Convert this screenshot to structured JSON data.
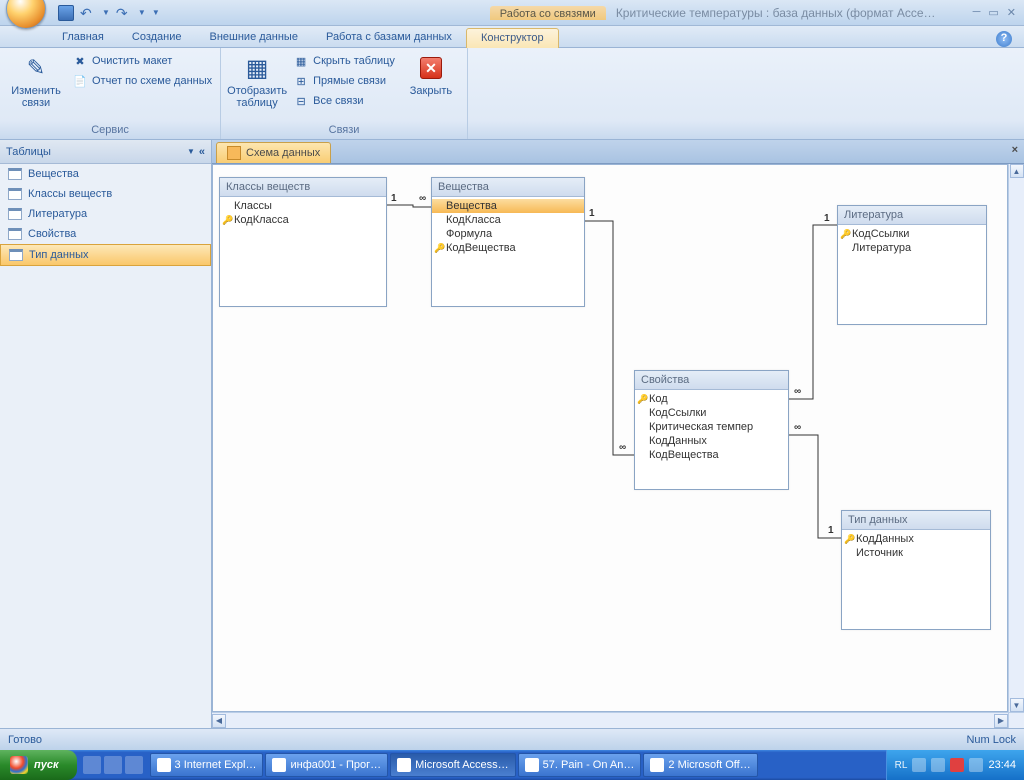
{
  "title": {
    "contextual": "Работа со связями",
    "document": "Критические температуры : база данных (формат Acce…"
  },
  "ribbon_tabs": [
    "Главная",
    "Создание",
    "Внешние данные",
    "Работа с базами данных"
  ],
  "contextual_tab": "Конструктор",
  "ribbon": {
    "group1": {
      "label": "Сервис",
      "big": "Изменить связи",
      "clear": "Очистить макет",
      "report": "Отчет по схеме данных"
    },
    "group2": {
      "label": "Связи",
      "show_table": "Отобразить таблицу",
      "hide": "Скрыть таблицу",
      "direct": "Прямые связи",
      "all": "Все связи",
      "close": "Закрыть"
    }
  },
  "nav": {
    "header": "Таблицы",
    "items": [
      "Вещества",
      "Классы веществ",
      "Литература",
      "Свойства",
      "Тип данных"
    ],
    "selected": 4
  },
  "doc_tab": "Схема данных",
  "tables": {
    "t1": {
      "title": "Классы веществ",
      "fields": [
        {
          "n": "Классы"
        },
        {
          "n": "КодКласса",
          "k": true
        }
      ]
    },
    "t2": {
      "title": "Вещества",
      "fields": [
        {
          "n": "Вещества",
          "sel": true
        },
        {
          "n": "КодКласса"
        },
        {
          "n": "Формула"
        },
        {
          "n": "КодВещества",
          "k": true
        }
      ]
    },
    "t3": {
      "title": "Свойства",
      "fields": [
        {
          "n": "Код",
          "k": true
        },
        {
          "n": "КодСсылки"
        },
        {
          "n": "Критическая темпер"
        },
        {
          "n": "КодДанных"
        },
        {
          "n": "КодВещества"
        }
      ]
    },
    "t4": {
      "title": "Литература",
      "fields": [
        {
          "n": "КодСсылки",
          "k": true
        },
        {
          "n": "Литература"
        }
      ]
    },
    "t5": {
      "title": "Тип данных",
      "fields": [
        {
          "n": "КодДанных",
          "k": true
        },
        {
          "n": "Источник"
        }
      ]
    }
  },
  "rel_labels": {
    "one": "1",
    "many": "∞"
  },
  "status": {
    "left": "Готово",
    "right": "Num Lock"
  },
  "taskbar": {
    "start": "пуск",
    "tasks": [
      "3 Internet Expl…",
      "инфа001 - Прог…",
      "Microsoft Access…",
      "57. Pain - On An…",
      "2 Microsoft Off…"
    ],
    "active": 2,
    "lang": "RL",
    "clock": "23:44"
  }
}
